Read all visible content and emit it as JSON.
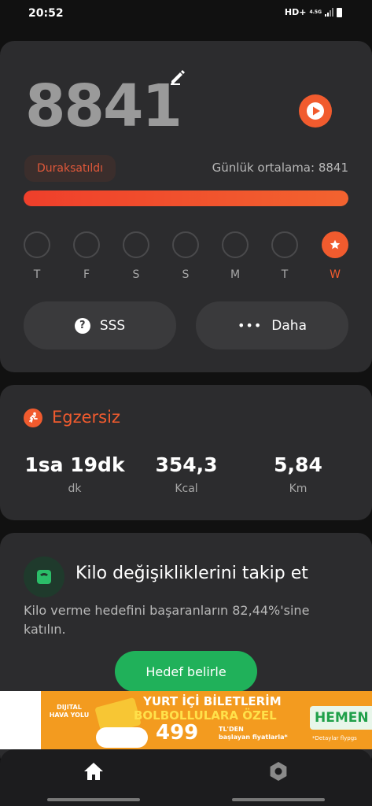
{
  "status_bar": {
    "time": "20:52",
    "network": "HD+",
    "network_small": "4.5G"
  },
  "steps": {
    "count": "8841",
    "status": "Duraksatıldı",
    "daily_average": "Günlük ortalama: 8841",
    "progress": 1.0,
    "days": [
      {
        "letter": "T",
        "active": false
      },
      {
        "letter": "F",
        "active": false
      },
      {
        "letter": "S",
        "active": false
      },
      {
        "letter": "S",
        "active": false
      },
      {
        "letter": "M",
        "active": false
      },
      {
        "letter": "T",
        "active": false
      },
      {
        "letter": "W",
        "active": true
      }
    ],
    "faq_label": "SSS",
    "more_label": "Daha"
  },
  "exercise": {
    "title": "Egzersiz",
    "stats": [
      {
        "value": "1sa 19dk",
        "unit": "dk"
      },
      {
        "value": "354,3",
        "unit": "Kcal"
      },
      {
        "value": "5,84",
        "unit": "Km"
      }
    ]
  },
  "weight": {
    "title": "Kilo değişikliklerini takip et",
    "description": "Kilo verme hedefini başaranların 82,44%'sine katılın.",
    "button_label": "Hedef belirle"
  },
  "ad": {
    "logo": "DIJITAL HAVA YOLU",
    "line1": "YURT İÇİ BİLETLERİM",
    "line2": "BOLBOLLULARA ÖZEL",
    "price": "499",
    "price_sub1": "TL'DEN",
    "price_sub2": "başlayan fiyatlarla*",
    "cta": "HEMEN",
    "note": "*Detaylar flypgs"
  },
  "colors": {
    "accent": "#f15b2e",
    "card": "#2c2c2e",
    "background": "#111111",
    "goal_button": "#20b15a"
  },
  "icons": {
    "edit": "pencil-icon",
    "play": "play-icon",
    "faq": "question-icon",
    "more": "more-dots-icon",
    "exercise": "running-icon",
    "weight": "scale-icon",
    "home": "home-icon",
    "settings": "settings-icon"
  }
}
